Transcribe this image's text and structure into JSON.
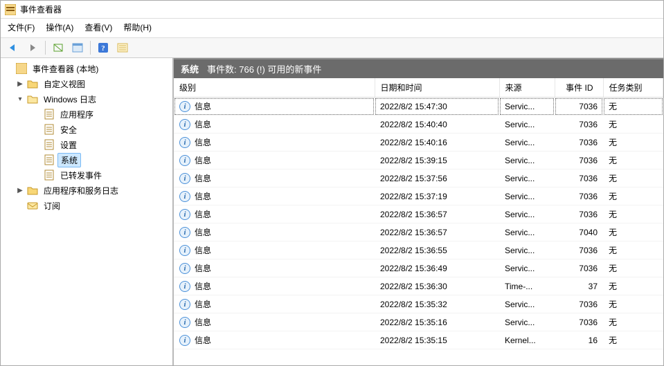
{
  "window": {
    "title": "事件查看器"
  },
  "menu": {
    "file": "文件(F)",
    "action": "操作(A)",
    "view": "查看(V)",
    "help": "帮助(H)"
  },
  "tree": {
    "root": "事件查看器 (本地)",
    "custom_views": "自定义视图",
    "windows_logs": "Windows 日志",
    "application": "应用程序",
    "security": "安全",
    "setup": "设置",
    "system": "系统",
    "forwarded": "已转发事件",
    "app_service_logs": "应用程序和服务日志",
    "subscriptions": "订阅"
  },
  "header": {
    "scope": "系统",
    "count_label": "事件数: 766 (!) 可用的新事件"
  },
  "columns": {
    "level": "级别",
    "datetime": "日期和时间",
    "source": "来源",
    "event_id": "事件 ID",
    "task": "任务类别"
  },
  "level_info": "信息",
  "events": [
    {
      "level": "信息",
      "datetime": "2022/8/2 15:47:30",
      "source": "Servic...",
      "event_id": "7036",
      "task": "无"
    },
    {
      "level": "信息",
      "datetime": "2022/8/2 15:40:40",
      "source": "Servic...",
      "event_id": "7036",
      "task": "无"
    },
    {
      "level": "信息",
      "datetime": "2022/8/2 15:40:16",
      "source": "Servic...",
      "event_id": "7036",
      "task": "无"
    },
    {
      "level": "信息",
      "datetime": "2022/8/2 15:39:15",
      "source": "Servic...",
      "event_id": "7036",
      "task": "无"
    },
    {
      "level": "信息",
      "datetime": "2022/8/2 15:37:56",
      "source": "Servic...",
      "event_id": "7036",
      "task": "无"
    },
    {
      "level": "信息",
      "datetime": "2022/8/2 15:37:19",
      "source": "Servic...",
      "event_id": "7036",
      "task": "无"
    },
    {
      "level": "信息",
      "datetime": "2022/8/2 15:36:57",
      "source": "Servic...",
      "event_id": "7036",
      "task": "无"
    },
    {
      "level": "信息",
      "datetime": "2022/8/2 15:36:57",
      "source": "Servic...",
      "event_id": "7040",
      "task": "无"
    },
    {
      "level": "信息",
      "datetime": "2022/8/2 15:36:55",
      "source": "Servic...",
      "event_id": "7036",
      "task": "无"
    },
    {
      "level": "信息",
      "datetime": "2022/8/2 15:36:49",
      "source": "Servic...",
      "event_id": "7036",
      "task": "无"
    },
    {
      "level": "信息",
      "datetime": "2022/8/2 15:36:30",
      "source": "Time-...",
      "event_id": "37",
      "task": "无"
    },
    {
      "level": "信息",
      "datetime": "2022/8/2 15:35:32",
      "source": "Servic...",
      "event_id": "7036",
      "task": "无"
    },
    {
      "level": "信息",
      "datetime": "2022/8/2 15:35:16",
      "source": "Servic...",
      "event_id": "7036",
      "task": "无"
    },
    {
      "level": "信息",
      "datetime": "2022/8/2 15:35:15",
      "source": "Kernel...",
      "event_id": "16",
      "task": "无"
    }
  ]
}
